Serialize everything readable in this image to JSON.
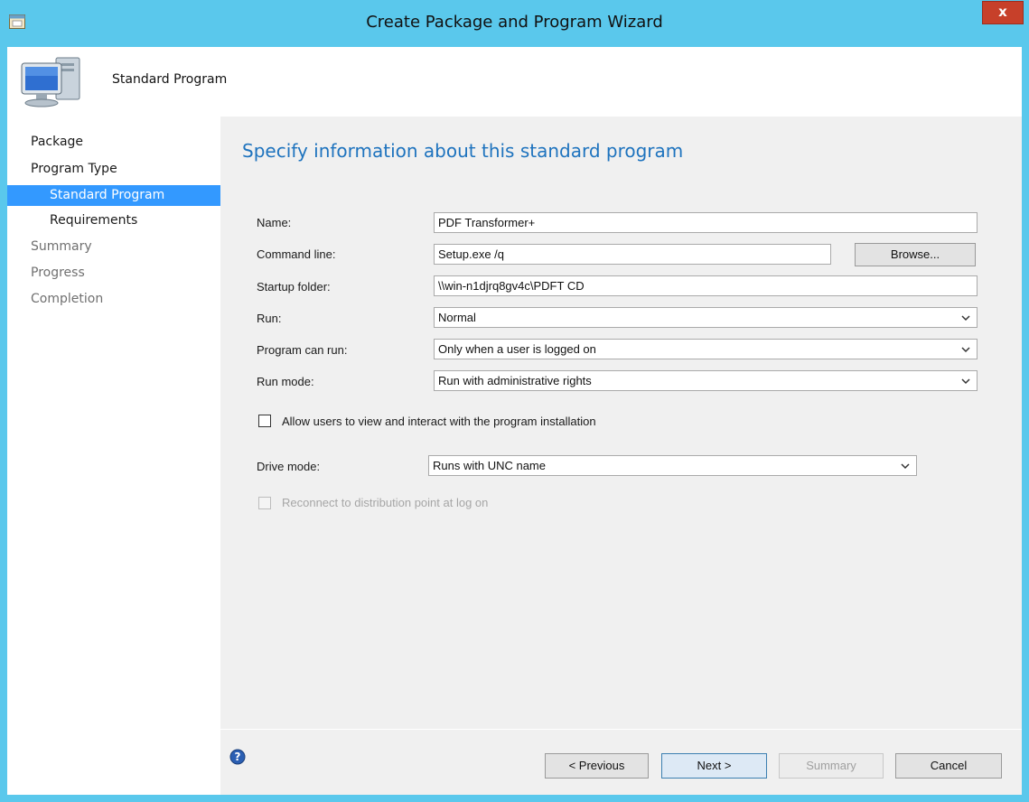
{
  "window": {
    "title": "Create Package and Program Wizard",
    "close_label": "x"
  },
  "header": {
    "title": "Standard Program"
  },
  "sidebar": {
    "items": [
      {
        "label": "Package"
      },
      {
        "label": "Program Type"
      },
      {
        "label": "Standard Program",
        "selected": true
      },
      {
        "label": "Requirements"
      },
      {
        "label": "Summary"
      },
      {
        "label": "Progress"
      },
      {
        "label": "Completion"
      }
    ]
  },
  "main": {
    "heading": "Specify information about this standard program",
    "name_label": "Name:",
    "name_value": "PDF Transformer+",
    "command_label": "Command line:",
    "command_value": "Setup.exe /q",
    "browse_label": "Browse...",
    "startup_label": "Startup folder:",
    "startup_value": "\\\\win-n1djrq8gv4c\\PDFT CD",
    "run_label": "Run:",
    "run_value": "Normal",
    "can_run_label": "Program can run:",
    "can_run_value": "Only when a user is logged on",
    "run_mode_label": "Run mode:",
    "run_mode_value": "Run with administrative rights",
    "allow_users_label": "Allow users to view and interact with the program installation",
    "allow_users_checked": false,
    "drive_mode_label": "Drive mode:",
    "drive_mode_value": "Runs with UNC name",
    "reconnect_label": "Reconnect to distribution point at log on",
    "reconnect_checked": false
  },
  "footer": {
    "previous_label": "< Previous",
    "next_label": "Next >",
    "summary_label": "Summary",
    "cancel_label": "Cancel"
  },
  "colors": {
    "titlebar": "#5ac8ec",
    "accent_heading": "#1e73be",
    "selection": "#3399ff",
    "close_button": "#c7402a"
  }
}
